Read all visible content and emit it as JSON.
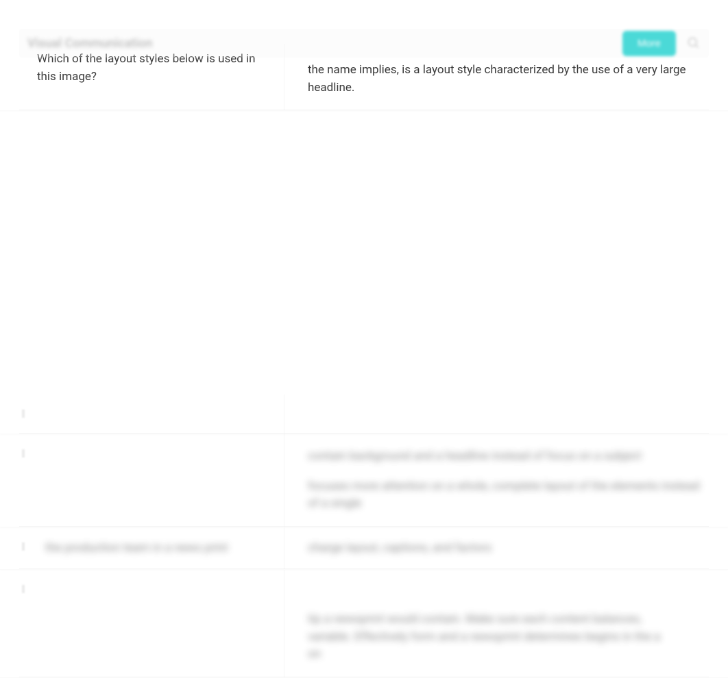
{
  "header": {
    "title": "Visual Communication",
    "more_label": "More",
    "search_placeholder": "Search"
  },
  "rows": [
    {
      "question": "Which of the layout styles below is used in this image?",
      "answer": "the name implies, is a layout style characterized by the use of a very large headline."
    },
    {
      "question": "",
      "answer": ""
    },
    {
      "question": "",
      "answer_line1": "contain background and a headline instead of focus on a subject",
      "answer_line2": "focuses more attention on a whole, complete layout of the elements instead of a single"
    },
    {
      "question": "the production team in a news print",
      "answer": "charge layout, captions, and factors"
    },
    {
      "question": "",
      "answer_line1": "tip a newsprint would contain. Make sure each content balances,",
      "answer_line2": "variable. Effectively form and a newsprint determines begins in the a",
      "answer_line3": "on"
    }
  ]
}
